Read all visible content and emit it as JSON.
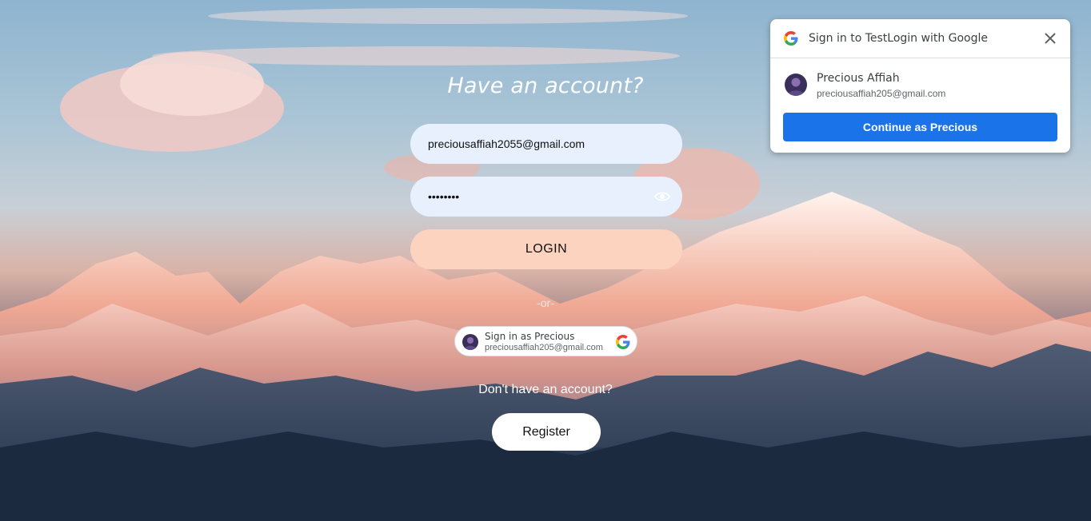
{
  "page": {
    "heading": "Have an account?",
    "or_separator": "-or-",
    "no_account_text": "Don't have an account?",
    "register_label": "Register"
  },
  "login_form": {
    "email_value": "preciousaffiah2055@gmail.com",
    "password_value": "••••••••",
    "login_label": "LOGIN",
    "show_password_icon": "eye-icon"
  },
  "google_chip": {
    "line1": "Sign in as Precious",
    "line2": "preciousaffiah205@gmail.com",
    "icon": "google-g-icon"
  },
  "one_tap_popup": {
    "title": "Sign in to TestLogin with Google",
    "account_name": "Precious Affiah",
    "account_email": "preciousaffiah205@gmail.com",
    "continue_label": "Continue as Precious",
    "close_icon": "close-icon",
    "accent_color": "#1a73e8"
  },
  "colors": {
    "input_bg": "#e8f0fe",
    "login_button_bg": "#fbd3bf"
  }
}
